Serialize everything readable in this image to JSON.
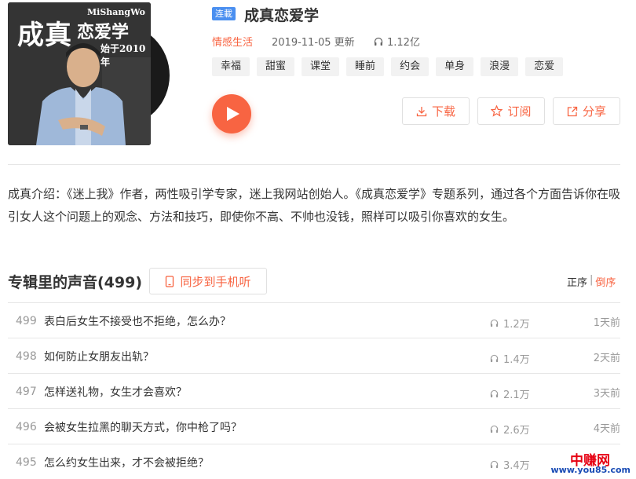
{
  "album": {
    "cover": {
      "brand": "MiShangWo",
      "title_part1": "成真",
      "title_part2": "恋爱学",
      "since": "始于2010年"
    },
    "badge": "连載",
    "title": "成真恋爱学",
    "category": "情感生活",
    "updated": "2019-11-05 更新",
    "plays": "1.12亿",
    "tags": [
      "幸福",
      "甜蜜",
      "课堂",
      "睡前",
      "约会",
      "单身",
      "浪漫",
      "恋爱"
    ],
    "actions": {
      "download": "下载",
      "subscribe": "订阅",
      "share": "分享"
    },
    "intro": "成真介绍：《迷上我》作者，两性吸引学专家，迷上我网站创始人。《成真恋爱学》专题系列，通过各个方面告诉你在吸引女人这个问题上的观念、方法和技巧，即使你不高、不帅也没钱，照样可以吸引你喜欢的女生。"
  },
  "tracks_section": {
    "title": "专辑里的声音(499)",
    "sync_label": "同步到手机听",
    "sort_asc": "正序",
    "sort_sep": "|",
    "sort_desc": "倒序"
  },
  "tracks": [
    {
      "num": "499",
      "title": "表白后女生不接受也不拒绝，怎么办？",
      "plays": "1.2万",
      "time": "1天前"
    },
    {
      "num": "498",
      "title": "如何防止女朋友出轨？",
      "plays": "1.4万",
      "time": "2天前"
    },
    {
      "num": "497",
      "title": "怎样送礼物，女生才会喜欢？",
      "plays": "2.1万",
      "time": "3天前"
    },
    {
      "num": "496",
      "title": "会被女生拉黑的聊天方式，你中枪了吗？",
      "plays": "2.6万",
      "time": "4天前"
    },
    {
      "num": "495",
      "title": "怎么约女生出来，才不会被拒绝？",
      "plays": "3.4万",
      "time": ""
    }
  ],
  "watermark": {
    "top": "中赚网",
    "bottom": "www.you85.com"
  },
  "colors": {
    "accent": "#f86442",
    "badge": "#4a8ff0",
    "watermark_red": "#e60012",
    "watermark_blue": "#1a4cb5"
  }
}
